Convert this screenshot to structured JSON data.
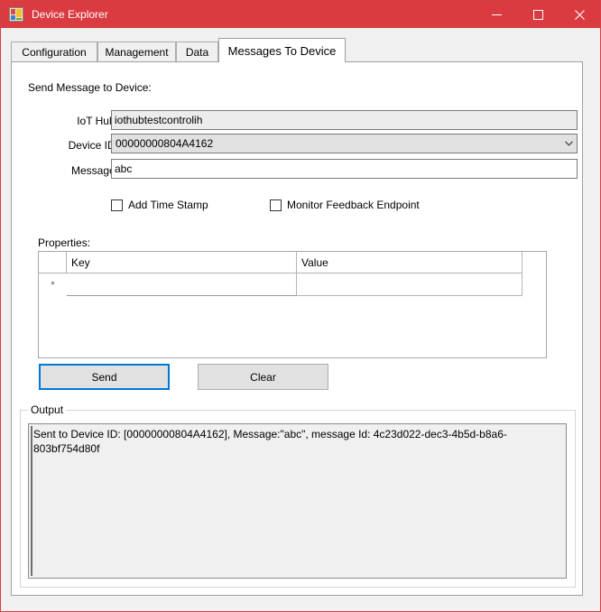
{
  "window": {
    "title": "Device Explorer",
    "icon": "app-form-icon",
    "accent_color": "#d93b41",
    "controls": [
      {
        "name": "minimize",
        "glyph": "minimize-icon"
      },
      {
        "name": "maximize",
        "glyph": "maximize-icon"
      },
      {
        "name": "close",
        "glyph": "close-icon"
      }
    ]
  },
  "tabs": [
    {
      "label": "Configuration",
      "selected": false
    },
    {
      "label": "Management",
      "selected": false
    },
    {
      "label": "Data",
      "selected": false
    },
    {
      "label": "Messages To Device",
      "selected": true
    }
  ],
  "form": {
    "section_title": "Send Message to Device:",
    "fields": {
      "iot_hub": {
        "label": "IoT Hub:",
        "value": "iothubtestcontrolih",
        "placeholder": "",
        "readonly": true
      },
      "device_id": {
        "label": "Device ID:",
        "value": "00000000804A4162",
        "arrow_icon": "chevron-down-icon"
      },
      "message": {
        "label": "Message:",
        "value": "abc",
        "placeholder": ""
      }
    },
    "checkboxes": [
      {
        "label": "Add Time Stamp",
        "checked": false
      },
      {
        "label": "Monitor Feedback Endpoint",
        "checked": false
      }
    ],
    "properties": {
      "label": "Properties:",
      "columns": [
        "",
        "Key",
        "Value"
      ],
      "new_row_marker": "*",
      "rows": []
    },
    "buttons": {
      "send": {
        "label": "Send",
        "focused": true
      },
      "clear": {
        "label": "Clear",
        "focused": false
      }
    }
  },
  "output": {
    "legend": "Output",
    "text": "Sent to Device ID: [00000000804A4162], Message:\"abc\", message Id: 4c23d022-dec3-4b5d-b8a6-803bf754d80f"
  }
}
